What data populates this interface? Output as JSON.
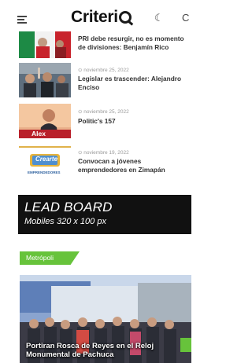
{
  "header": {
    "logo_text": "Criteri",
    "theme_icon": "☾",
    "extra_icon": "C"
  },
  "articles": [
    {
      "date": "",
      "title": "PRI debe resurgir, no es momento de divisiones: Benjamín Rico"
    },
    {
      "date": "noviembre 25, 2022",
      "title": "Legislar es trascender: Alejandro Enciso"
    },
    {
      "date": "noviembre 25, 2022",
      "title": "Politic's 157"
    },
    {
      "date": "noviembre 19, 2022",
      "title": "Convocan a jóvenes emprendedores en Zimapán"
    }
  ],
  "thumbs": {
    "alex_label": "Alex",
    "crearte_label": "Crearte",
    "crearte_sub": "EMPRENDEDORES"
  },
  "ad": {
    "title": "LEAD BOARD",
    "subtitle": "Mobiles  320 x 100 px"
  },
  "section": {
    "category": "Metrópoli",
    "feature_title": "Portiran Rosca de Reyes en el Reloj Monumental de Pachuca"
  },
  "colors": {
    "accent_green": "#67c33b",
    "ad_background": "#111111"
  }
}
